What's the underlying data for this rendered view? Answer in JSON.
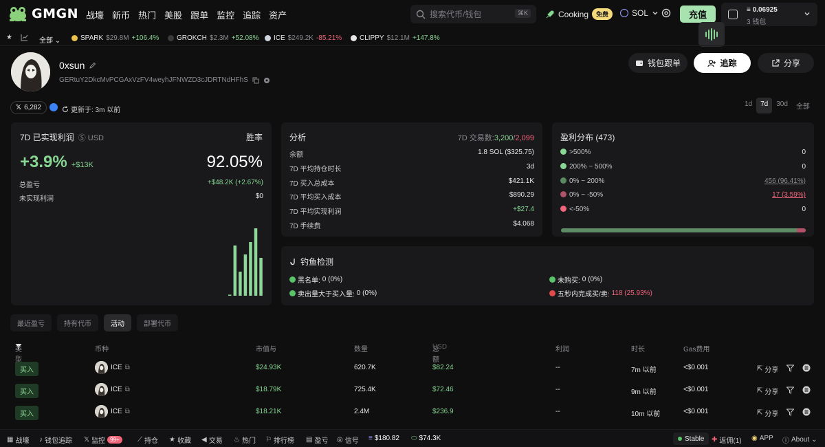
{
  "nav": {
    "logo_text": "GMGN",
    "items": [
      "战壕",
      "新币",
      "热门",
      "美股",
      "跟单",
      "监控",
      "追踪",
      "资产"
    ],
    "search_placeholder": "搜索代币/钱包",
    "search_shortcut": "⌘K",
    "cooking_label": "Cooking",
    "free_badge": "免费",
    "chain": "SOL",
    "recharge_label": "充值",
    "wallet_balance": "0.06925",
    "wallet_count": "3 钱包"
  },
  "ticker": {
    "filter_label": "全部",
    "items": [
      {
        "name": "SPARK",
        "price": "$29.8M",
        "change": "+106.4%",
        "dir": "up",
        "color": "#e8c14a"
      },
      {
        "name": "GROKCH",
        "price": "$2.3M",
        "change": "+52.08%",
        "dir": "up",
        "color": "#1a1a1a"
      },
      {
        "name": "ICE",
        "price": "$249.2K",
        "change": "-85.21%",
        "dir": "down",
        "color": "#cfd6e0"
      },
      {
        "name": "CLIPPY",
        "price": "$12.1M",
        "change": "+147.8%",
        "dir": "up",
        "color": "#e6e6e6"
      }
    ]
  },
  "profile": {
    "name": "0xsun",
    "address": "GERtuY2DkcMvPCGAxVzFV4weyhJFNWZD3cJDRTNdHFhS",
    "x_followers": "6,282",
    "updated": "更新于: 3m 以前",
    "btn_copy_trade": "钱包跟单",
    "btn_track": "追踪",
    "btn_share": "分享",
    "periods": [
      "1d",
      "7d",
      "30d",
      "全部"
    ],
    "active_period": "7d"
  },
  "pnl": {
    "title": "7D 已实现利润",
    "currency": "USD",
    "winrate_label": "胜率",
    "pct": "+3.9%",
    "amount": "+$13K",
    "winrate": "92.05%",
    "total_label": "总盈亏",
    "total_value": "+$48.2K (+2.67%)",
    "unrealized_label": "未实现利润",
    "unrealized_value": "$0"
  },
  "chart_data": {
    "type": "bar",
    "values": [
      0.01,
      0.73,
      0.35,
      0.6,
      0.78,
      0.98,
      0.55,
      0.9
    ]
  },
  "analysis": {
    "title": "分析",
    "trades_label": "7D 交易数:",
    "trades_buy": "3,200",
    "trades_sell": "2,099",
    "rows": [
      {
        "k": "余额",
        "v": "1.8 SOL ($325.75)",
        "tone": "white"
      },
      {
        "k": "7D 平均持仓时长",
        "v": "3d",
        "tone": "white"
      },
      {
        "k": "7D 买入总成本",
        "v": "$421.1K",
        "tone": "white"
      },
      {
        "k": "7D 平均买入成本",
        "v": "$890.29",
        "tone": "white"
      },
      {
        "k": "7D 平均实现利润",
        "v": "+$27.4",
        "tone": "green"
      },
      {
        "k": "7D 手续费",
        "v": "$4.068",
        "tone": "white"
      }
    ]
  },
  "distribution": {
    "title": "盈利分布 (473)",
    "rows": [
      {
        "k": ">500%",
        "v": "0",
        "dot": "#88d693",
        "tone": "white",
        "ul": false
      },
      {
        "k": "200% ~ 500%",
        "v": "0",
        "dot": "#88d693",
        "tone": "white",
        "ul": false
      },
      {
        "k": "0% ~ 200%",
        "v": "456 (96.41%)",
        "dot": "#5a8a62",
        "tone": "muted",
        "ul": true
      },
      {
        "k": "0% ~ -50%",
        "v": "17 (3.59%)",
        "dot": "#b05268",
        "tone": "red",
        "ul": true
      },
      {
        "k": "<-50%",
        "v": "0",
        "dot": "#f0657a",
        "tone": "white",
        "ul": false
      }
    ],
    "bar": {
      "win_pct": 96.41,
      "loss_pct": 3.59
    }
  },
  "phishing": {
    "title": "钓鱼检测",
    "items": [
      {
        "label": "黑名单:",
        "value": "0 (0%)",
        "dot": "#59c36a",
        "tone": "white"
      },
      {
        "label": "未购买:",
        "value": "0 (0%)",
        "dot": "#59c36a",
        "tone": "white"
      },
      {
        "label": "卖出量大于买入量:",
        "value": "0 (0%)",
        "dot": "#59c36a",
        "tone": "white"
      },
      {
        "label": "五秒内完成买/卖:",
        "value": "118 (25.93%)",
        "dot": "#e24b4b",
        "tone": "red"
      }
    ]
  },
  "tabs": [
    "最近盈亏",
    "持有代币",
    "活动",
    "部署代币"
  ],
  "active_tab": "活动",
  "table": {
    "headers": {
      "type": "类型",
      "coin": "币种",
      "mcap": "市值与",
      "qty": "数量",
      "total": "总额",
      "total_unit": "USD",
      "profit": "利润",
      "age": "时长",
      "gas": "Gas费用"
    },
    "share_label": "分享",
    "rows": [
      {
        "type": "买入",
        "coin": "ICE",
        "mcap": "$24.93K",
        "qty": "620.7K",
        "total": "$82.24",
        "profit": "--",
        "age": "7m 以前",
        "gas": "<$0.001"
      },
      {
        "type": "买入",
        "coin": "ICE",
        "mcap": "$18.79K",
        "qty": "725.4K",
        "total": "$72.46",
        "profit": "--",
        "age": "9m 以前",
        "gas": "<$0.001"
      },
      {
        "type": "买入",
        "coin": "ICE",
        "mcap": "$18.21K",
        "qty": "2.4M",
        "total": "$236.9",
        "profit": "--",
        "age": "10m 以前",
        "gas": "<$0.001"
      }
    ]
  },
  "bottom": {
    "items": [
      "战壕",
      "钱包追踪",
      "监控",
      "持仓",
      "收藏",
      "交易",
      "热门",
      "排行榜",
      "盈亏",
      "信号"
    ],
    "monitor_badge": "99+",
    "sol_price": "$180.82",
    "pill_price": "$74.3K",
    "stable": "Stable",
    "rebate": "返佣(1)",
    "app": "APP",
    "about": "About"
  }
}
